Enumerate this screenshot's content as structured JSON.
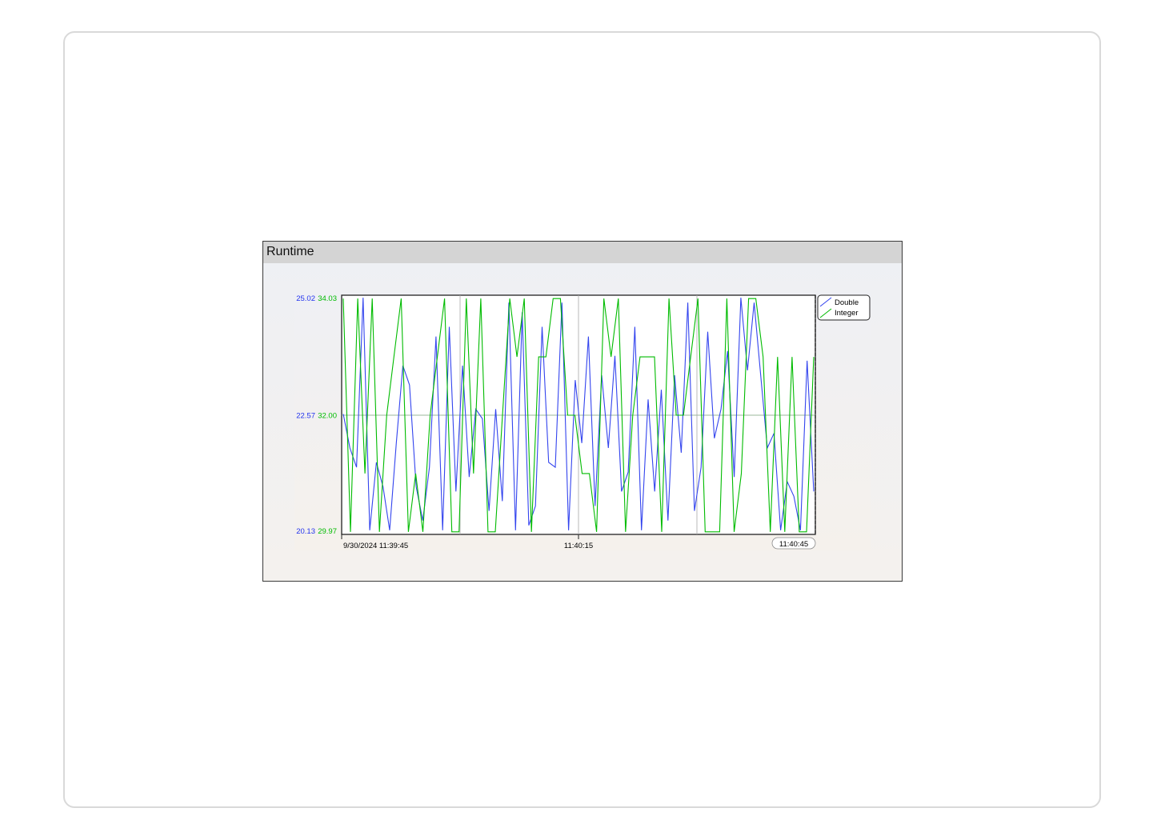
{
  "window": {
    "title": "Runtime"
  },
  "chart_data": {
    "type": "line",
    "x_labels": [
      "9/30/2024 11:39:45",
      "11:40:15",
      "11:40:45"
    ],
    "y_axes": [
      {
        "color": "#2233ee",
        "ticks": [
          "25.02",
          "22.57",
          "20.13"
        ],
        "range": [
          20.13,
          25.02
        ]
      },
      {
        "color": "#00bb00",
        "ticks": [
          "34.03",
          "32.00",
          "29.97"
        ],
        "range": [
          29.97,
          34.03
        ]
      }
    ],
    "legend": {
      "position": "top-right"
    },
    "grid": true,
    "series": [
      {
        "name": "Double",
        "color": "#3344ee",
        "axis": 0,
        "values": [
          22.6,
          21.9,
          21.5,
          25.0,
          20.2,
          21.6,
          21.1,
          20.2,
          22.0,
          23.6,
          23.2,
          21.1,
          20.4,
          21.5,
          24.2,
          20.2,
          24.4,
          21.0,
          23.6,
          21.3,
          22.7,
          22.5,
          20.6,
          22.7,
          20.8,
          24.9,
          20.2,
          24.7,
          20.3,
          20.7,
          24.4,
          21.6,
          21.5,
          24.9,
          20.2,
          23.3,
          22.0,
          24.2,
          20.7,
          23.4,
          21.9,
          23.8,
          21.0,
          21.4,
          24.4,
          20.2,
          22.9,
          21.0,
          23.1,
          20.4,
          23.4,
          21.8,
          24.9,
          20.6,
          21.5,
          24.3,
          22.1,
          22.7,
          23.9,
          21.3,
          25.0,
          23.5,
          24.9,
          23.4,
          21.9,
          22.2,
          20.2,
          21.2,
          20.9,
          20.2,
          23.7,
          21.0
        ]
      },
      {
        "name": "Integer",
        "color": "#00bb00",
        "axis": 1,
        "values": [
          34,
          30,
          34,
          31,
          34,
          30,
          32,
          33,
          34,
          30,
          31,
          30,
          32,
          33,
          34,
          30,
          30,
          34,
          31,
          34,
          30,
          30,
          32,
          34,
          33,
          34,
          30,
          33,
          33,
          34,
          34,
          32,
          32,
          31,
          31,
          30,
          34,
          33,
          34,
          30,
          32,
          33,
          33,
          33,
          30,
          34,
          32,
          32,
          33,
          34,
          30,
          30,
          30,
          34,
          30,
          31,
          34,
          34,
          33,
          30,
          33,
          30,
          33,
          30,
          30,
          33
        ]
      }
    ]
  }
}
